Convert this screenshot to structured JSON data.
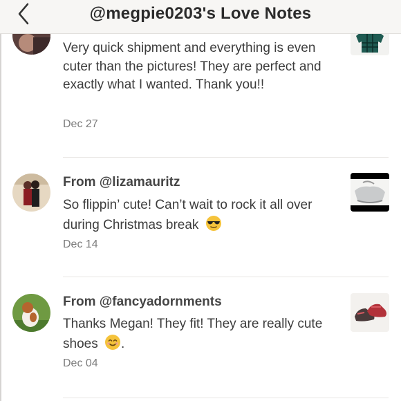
{
  "header": {
    "title": "@megpie0203's Love Notes"
  },
  "notes": [
    {
      "message": "Very quick shipment and everything is even cuter than the pictures! They are perfect and exactly what I wanted. Thank you!!",
      "date": "Dec 27",
      "thumbnail_icon": "onesie-photo"
    },
    {
      "from": "From @lizamauritz",
      "message": "So flippin’ cute! Can’t wait to rock it all over during Christmas break",
      "emoji_icon": "sunglasses-face-emoji",
      "date": "Dec 14",
      "thumbnail_icon": "jacket-photo"
    },
    {
      "from": "From @fancyadornments",
      "message": "Thanks Megan! They fit! They are really cute shoes",
      "message_suffix": ".",
      "emoji_icon": "smiling-face-emoji",
      "date": "Dec 04",
      "thumbnail_icon": "shoes-photo"
    }
  ],
  "colors": {
    "header_bg": "#f7f6f4",
    "text": "#3c3c3c",
    "date": "#7c7c7c",
    "emoji": "#f5c33b"
  }
}
